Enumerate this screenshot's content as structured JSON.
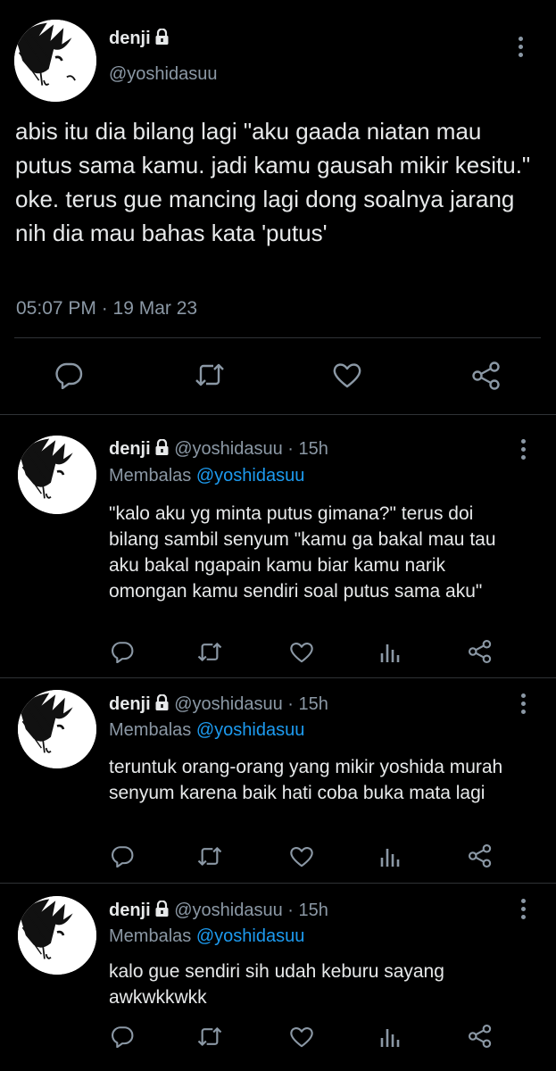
{
  "main_tweet": {
    "display_name": "denji",
    "handle": "@yoshidasuu",
    "text": "abis itu dia bilang lagi \"aku gaada niatan mau putus sama kamu. jadi kamu gausah mikir kesitu.\" oke. terus gue mancing lagi dong soalnya jarang nih dia mau bahas kata 'putus'",
    "timestamp": "05:07 PM · 19 Mar 23",
    "actions": [
      "reply-icon",
      "retweet-icon",
      "like-icon",
      "share-icon"
    ]
  },
  "replies": [
    {
      "display_name": "denji",
      "handle": "@yoshidasuu",
      "age": "· 15h",
      "replying_prefix": "Membalas",
      "replying_to": "@yoshidasuu",
      "text": "\"kalo aku yg minta putus gimana?\" terus doi bilang sambil senyum \"kamu ga bakal mau tau aku bakal ngapain kamu biar kamu narik omongan kamu sendiri soal putus sama aku\""
    },
    {
      "display_name": "denji",
      "handle": "@yoshidasuu",
      "age": "· 15h",
      "replying_prefix": "Membalas",
      "replying_to": "@yoshidasuu",
      "text": "teruntuk orang-orang yang mikir yoshida murah senyum karena baik hati coba buka mata lagi"
    },
    {
      "display_name": "denji",
      "handle": "@yoshidasuu",
      "age": "· 15h",
      "replying_prefix": "Membalas",
      "replying_to": "@yoshidasuu",
      "text": "kalo gue sendiri sih udah keburu sayang awkwkkwkk"
    }
  ],
  "colors": {
    "background": "#000000",
    "text": "#e7e9ea",
    "secondary": "#8b98a5",
    "accent": "#1d9bf0",
    "divider": "#2f3336"
  }
}
